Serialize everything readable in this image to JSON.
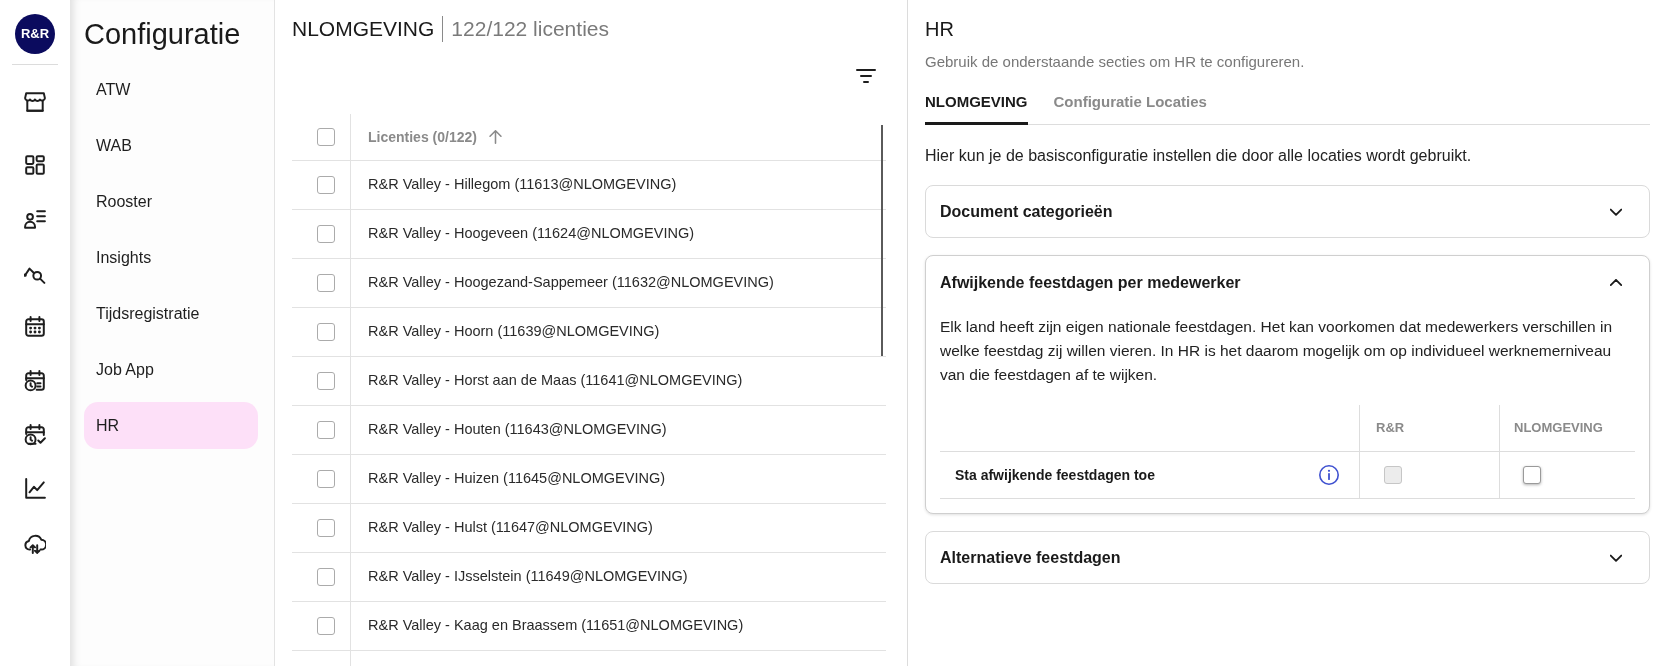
{
  "rail": {
    "logo": "R&R"
  },
  "config_menu": {
    "title": "Configuratie",
    "items": [
      {
        "label": "ATW",
        "selected": false
      },
      {
        "label": "WAB",
        "selected": false
      },
      {
        "label": "Rooster",
        "selected": false
      },
      {
        "label": "Insights",
        "selected": false
      },
      {
        "label": "Tijdsregistratie",
        "selected": false
      },
      {
        "label": "Job App",
        "selected": false
      },
      {
        "label": "HR",
        "selected": true
      }
    ]
  },
  "licenses": {
    "environment": "NLOMGEVING",
    "count": "122/122 licenties",
    "table": {
      "header_checked": false,
      "column": "Licenties (0/122)",
      "rows": [
        {
          "label": "R&R Valley - Hillegom (11613@NLOMGEVING)",
          "checked": false
        },
        {
          "label": "R&R Valley - Hoogeveen (11624@NLOMGEVING)",
          "checked": false
        },
        {
          "label": "R&R Valley - Hoogezand-Sappemeer (11632@NLOMGEVING)",
          "checked": false
        },
        {
          "label": "R&R Valley - Hoorn (11639@NLOMGEVING)",
          "checked": false
        },
        {
          "label": "R&R Valley - Horst aan de Maas (11641@NLOMGEVING)",
          "checked": false
        },
        {
          "label": "R&R Valley - Houten (11643@NLOMGEVING)",
          "checked": false
        },
        {
          "label": "R&R Valley - Huizen (11645@NLOMGEVING)",
          "checked": false
        },
        {
          "label": "R&R Valley - Hulst (11647@NLOMGEVING)",
          "checked": false
        },
        {
          "label": "R&R Valley - IJsselstein (11649@NLOMGEVING)",
          "checked": false
        },
        {
          "label": "R&R Valley - Kaag en Braassem (11651@NLOMGEVING)",
          "checked": false
        }
      ]
    }
  },
  "detail": {
    "title": "HR",
    "subtitle": "Gebruik de onderstaande secties om HR te configureren.",
    "tabs": [
      {
        "label": "NLOMGEVING",
        "selected": true
      },
      {
        "label": "Configuratie Locaties",
        "selected": false
      }
    ],
    "intro": "Hier kun je de basisconfiguratie instellen die door alle locaties wordt gebruikt.",
    "sections": [
      {
        "title": "Document categorieën",
        "expanded": false
      },
      {
        "title": "Afwijkende feestdagen per medewerker",
        "expanded": true,
        "description": "Elk land heeft zijn eigen nationale feestdagen. Het kan voorkomen dat medewerkers verschillen in welke feestdag zij willen vieren. In HR is het daarom mogelijk om op individueel werknemerniveau van die feestdagen af te wijken.",
        "columns": [
          "R&R",
          "NLOMGEVING"
        ],
        "rows": [
          {
            "label": "Sta afwijkende feestdagen toe",
            "values": [
              {
                "checked": false,
                "disabled": true
              },
              {
                "checked": false,
                "disabled": false
              }
            ]
          }
        ]
      },
      {
        "title": "Alternatieve feestdagen",
        "expanded": false
      }
    ]
  }
}
